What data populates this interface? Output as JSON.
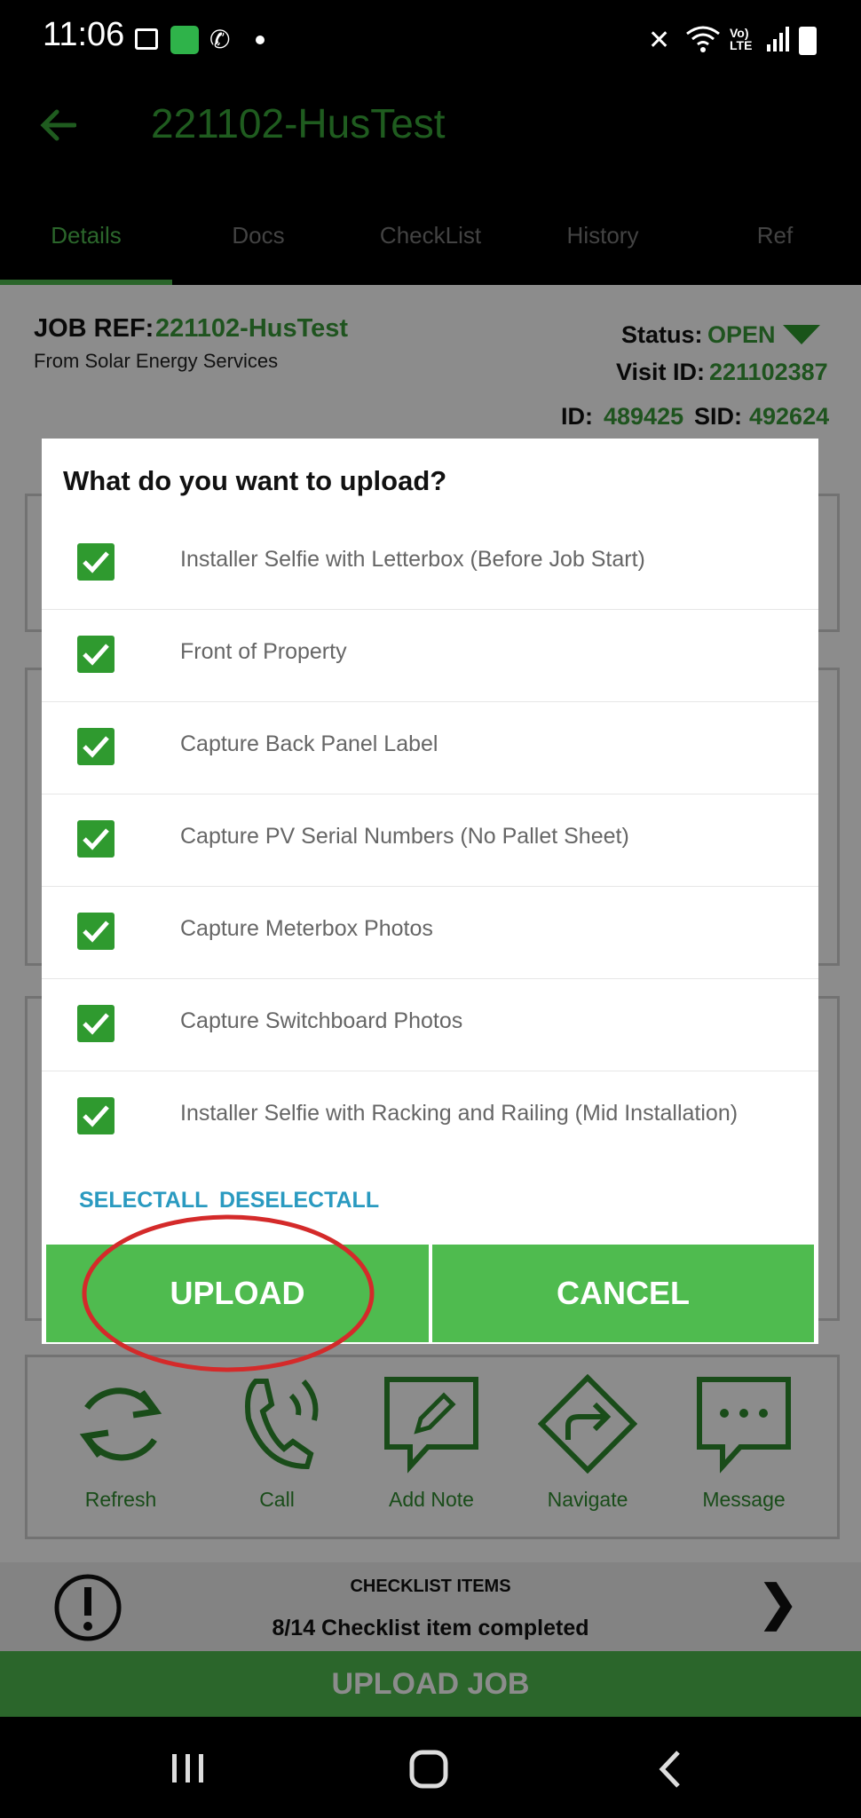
{
  "status_bar": {
    "time": "11:06"
  },
  "app_bar": {
    "title": "221102-HusTest"
  },
  "tabs": [
    {
      "label": "Details"
    },
    {
      "label": "Docs"
    },
    {
      "label": "CheckList"
    },
    {
      "label": "History"
    },
    {
      "label": "Ref"
    }
  ],
  "job": {
    "ref_label": "JOB REF:",
    "ref_value": "221102-HusTest",
    "from": "From Solar Energy Services",
    "status_label": "Status:",
    "status_value": "OPEN",
    "visit_label": "Visit ID:",
    "visit_value": "221102387",
    "id_label": "ID:",
    "id_value": "489425",
    "sid_label": "SID:",
    "sid_value": "492624"
  },
  "actions": [
    {
      "label": "Refresh",
      "icon": "refresh-icon"
    },
    {
      "label": "Call",
      "icon": "phone-icon"
    },
    {
      "label": "Add Note",
      "icon": "add-note-icon"
    },
    {
      "label": "Navigate",
      "icon": "navigate-icon"
    },
    {
      "label": "Message",
      "icon": "message-icon"
    }
  ],
  "checklist": {
    "title": "CHECKLIST ITEMS",
    "summary": "8/14 Checklist item completed",
    "arrow": "❯"
  },
  "upload_job_label": "UPLOAD JOB",
  "dialog": {
    "title": "What do you want to upload?",
    "items": [
      {
        "label": "Installer Selfie with Letterbox (Before Job Start)",
        "checked": true
      },
      {
        "label": "Front of Property",
        "checked": true
      },
      {
        "label": "Capture Back Panel Label",
        "checked": true
      },
      {
        "label": "Capture PV Serial Numbers (No Pallet Sheet)",
        "checked": true
      },
      {
        "label": "Capture Meterbox Photos",
        "checked": true
      },
      {
        "label": "Capture Switchboard Photos",
        "checked": true
      },
      {
        "label": "Installer Selfie with Racking and Railing (Mid Installation)",
        "checked": true
      }
    ],
    "select_all": "SELECTALL",
    "deselect_all": "DESELECTALL",
    "upload": "UPLOAD",
    "cancel": "CANCEL"
  },
  "colors": {
    "accent_green": "#4fbb4f",
    "dark_green": "#2f9a2f",
    "link_blue": "#2a9ac0",
    "highlight_red": "#d42a2a"
  }
}
